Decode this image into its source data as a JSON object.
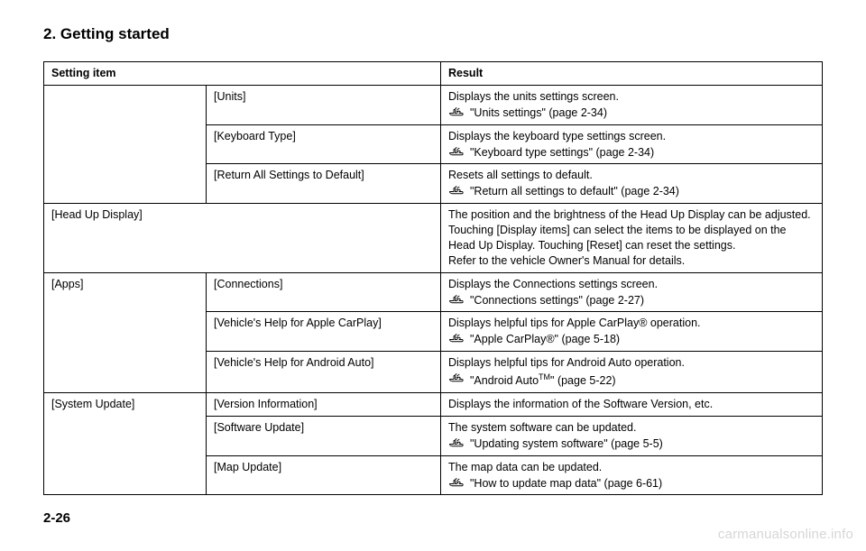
{
  "heading": "2. Getting started",
  "page_number": "2-26",
  "watermark": "carmanualsonline.info",
  "table": {
    "head": {
      "c1": "Setting item",
      "c2": "Result"
    },
    "rows": [
      {
        "a": "",
        "b": "[Units]",
        "c_text": "Displays the units settings screen.",
        "c_ref": "\"Units settings\" (page 2-34)"
      },
      {
        "a": "",
        "b": "[Keyboard Type]",
        "c_text": "Displays the keyboard type settings screen.",
        "c_ref": "\"Keyboard type settings\" (page 2-34)"
      },
      {
        "a": "",
        "b": "[Return All Settings to Default]",
        "c_text": "Resets all settings to default.",
        "c_ref": "\"Return all settings to default\" (page 2-34)"
      },
      {
        "a": "[Head Up Display]",
        "b": "",
        "c_text": "The position and the brightness of the Head Up Display can be adjusted. Touching [Display items] can select the items to be displayed on the Head Up Display. Touching [Reset] can reset the settings.\nRefer to the vehicle Owner's Manual for details.",
        "c_ref": ""
      },
      {
        "a": "[Apps]",
        "b": "[Connections]",
        "c_text": "Displays the Connections settings screen.",
        "c_ref": "\"Connections settings\" (page 2-27)"
      },
      {
        "a": "",
        "b": "[Vehicle's Help for Apple CarPlay]",
        "c_text": "Displays helpful tips for Apple CarPlay® operation.",
        "c_ref": "\"Apple CarPlay®\" (page 5-18)"
      },
      {
        "a": "",
        "b": "[Vehicle's Help for Android Auto]",
        "c_text": "Displays helpful tips for Android Auto operation.",
        "c_ref_html": "\"Android Auto<span class='tm'>TM</span>\" (page 5-22)"
      },
      {
        "a": "[System Update]",
        "b": "[Version Information]",
        "c_text": "Displays the information of the Software Version, etc.",
        "c_ref": ""
      },
      {
        "a": "",
        "b": "[Software Update]",
        "c_text": "The system software can be updated.",
        "c_ref": "\"Updating system software\" (page 5-5)"
      },
      {
        "a": "",
        "b": "[Map Update]",
        "c_text": "The map data can be updated.",
        "c_ref": "\"How to update map data\" (page 6-61)"
      }
    ]
  }
}
